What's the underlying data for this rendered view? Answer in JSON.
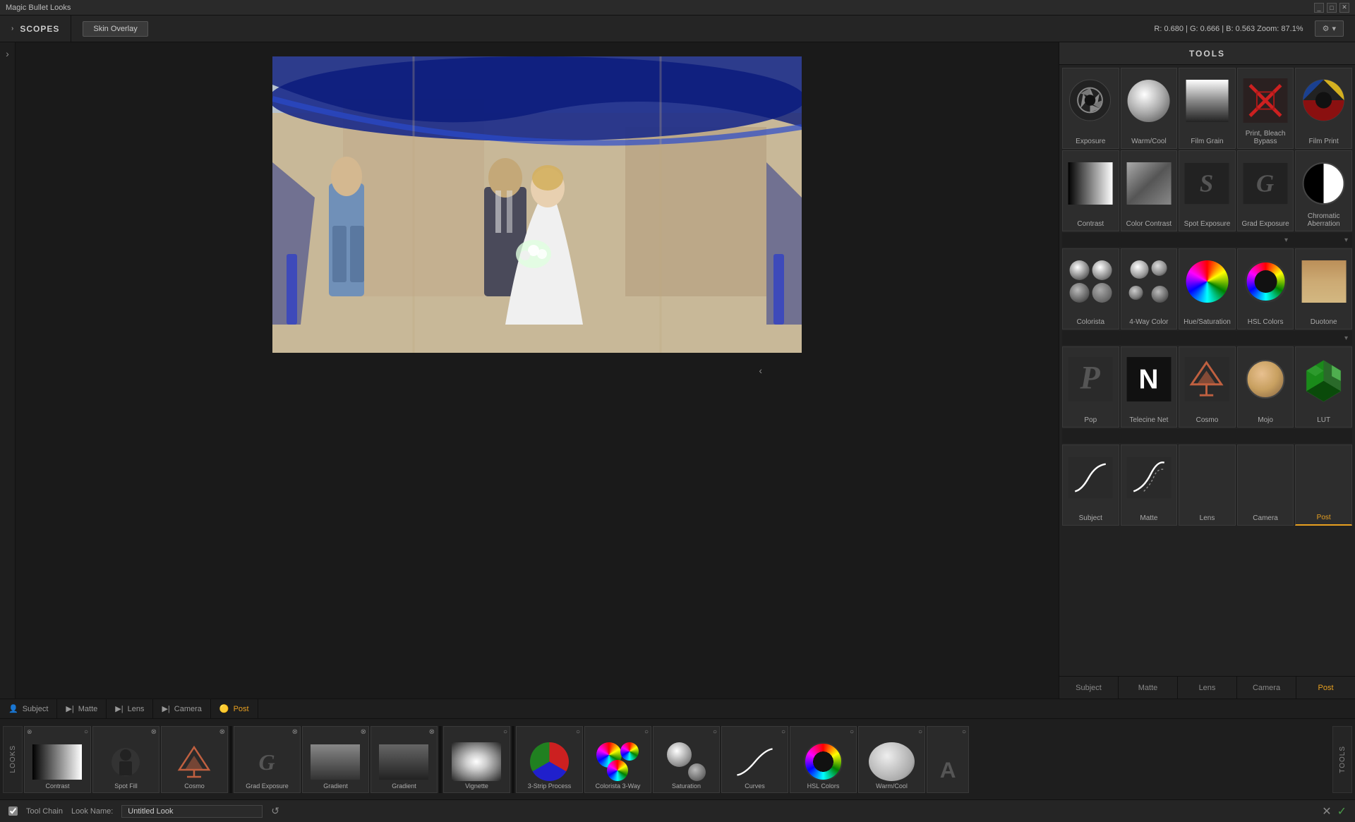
{
  "titlebar": {
    "title": "Magic Bullet Looks",
    "controls": [
      "_",
      "□",
      "✕"
    ]
  },
  "topbar": {
    "scopes_label": "SCOPES",
    "skin_overlay_label": "Skin Overlay",
    "color_info": "R: 0.680  |  G: 0.666  |  B: 0.563    Zoom: 87.1%",
    "settings_label": "⚙ ▾"
  },
  "tools": {
    "header": "TOOLS",
    "rows": [
      [
        {
          "id": "exposure",
          "label": "Exposure",
          "icon": "exposure"
        },
        {
          "id": "warm-cool",
          "label": "Warm/Cool",
          "icon": "sphere"
        },
        {
          "id": "film-grain",
          "label": "Film Grain",
          "icon": "grain"
        },
        {
          "id": "print-bleach",
          "label": "Print, Bleach Bypass",
          "icon": "print-bleach"
        },
        {
          "id": "film-print",
          "label": "Film Print",
          "icon": "film-print"
        }
      ],
      [
        {
          "id": "contrast",
          "label": "Contrast",
          "icon": "contrast"
        },
        {
          "id": "color-contrast",
          "label": "Color Contrast",
          "icon": "color-contrast"
        },
        {
          "id": "spot-exposure",
          "label": "Spot Exposure",
          "icon": "spot"
        },
        {
          "id": "grad-exposure",
          "label": "Grad Exposure",
          "icon": "grad"
        },
        {
          "id": "chromatic",
          "label": "Chromatic Aberration",
          "icon": "chromatic"
        }
      ],
      [
        {
          "id": "colorista",
          "label": "Colorista",
          "icon": "colorista"
        },
        {
          "id": "4way-color",
          "label": "4-Way Color",
          "icon": "fourway"
        },
        {
          "id": "hue-sat",
          "label": "Hue/Saturation",
          "icon": "hue"
        },
        {
          "id": "hsl-colors",
          "label": "HSL Colors",
          "icon": "hsl-colors"
        },
        {
          "id": "duotone",
          "label": "Duotone",
          "icon": "duotone"
        }
      ],
      [
        {
          "id": "pop",
          "label": "Pop",
          "icon": "pop"
        },
        {
          "id": "telecine-net",
          "label": "Telecine Net",
          "icon": "telecine"
        },
        {
          "id": "cosmo",
          "label": "Cosmo",
          "icon": "cosmo"
        },
        {
          "id": "mojo",
          "label": "Mojo",
          "icon": "mojo"
        },
        {
          "id": "lut",
          "label": "LUT",
          "icon": "lut"
        }
      ],
      [
        {
          "id": "subject-tool",
          "label": "Subject",
          "icon": "curves-s"
        },
        {
          "id": "matte-tool",
          "label": "Matte",
          "icon": "curves-diag"
        },
        {
          "id": "lens-tool",
          "label": "Lens",
          "icon": ""
        },
        {
          "id": "camera-tool",
          "label": "Camera",
          "icon": ""
        },
        {
          "id": "post-tool",
          "label": "Post",
          "icon": ""
        }
      ]
    ],
    "tabs": [
      {
        "id": "subject",
        "label": "Subject",
        "active": false
      },
      {
        "id": "matte",
        "label": "Matte",
        "active": false
      },
      {
        "id": "lens",
        "label": "Lens",
        "active": false
      },
      {
        "id": "camera",
        "label": "Camera",
        "active": false
      },
      {
        "id": "post",
        "label": "Post",
        "active": true
      }
    ]
  },
  "filmstrip": {
    "items": [
      {
        "id": "contrast-film",
        "label": "Contrast",
        "icon": "contrast",
        "close": true,
        "enable": true
      },
      {
        "id": "spot-film",
        "label": "Spot Fill",
        "icon": "spot-fill",
        "close": true,
        "enable": true
      },
      {
        "id": "cosmo-film",
        "label": "Cosmo",
        "icon": "cosmo",
        "close": true,
        "enable": true
      },
      {
        "id": "grad-exp-film",
        "label": "Grad Exposure",
        "icon": "grad",
        "close": true,
        "enable": true,
        "separator": true
      },
      {
        "id": "gradient-film",
        "label": "Gradient",
        "icon": "gradient",
        "close": true,
        "enable": true
      },
      {
        "id": "gradient2-film",
        "label": "Gradient",
        "icon": "gradient2",
        "close": true,
        "enable": true
      },
      {
        "id": "vignette-film",
        "label": "Vignette",
        "icon": "vignette",
        "close": true,
        "enable": true,
        "separator": true
      },
      {
        "id": "3strip-film",
        "label": "3-Strip Process",
        "icon": "pie",
        "close": true,
        "enable": true
      },
      {
        "id": "c3way-film",
        "label": "Colorista 3-Way",
        "icon": "c3way",
        "close": true,
        "enable": true
      },
      {
        "id": "saturation-film",
        "label": "Saturation",
        "icon": "saturation",
        "close": true,
        "enable": true
      },
      {
        "id": "curves-film",
        "label": "Curves",
        "icon": "curves-line",
        "close": true,
        "enable": true
      },
      {
        "id": "hsl-film",
        "label": "HSL Colors",
        "icon": "hsl",
        "close": true,
        "enable": true
      },
      {
        "id": "warmc-film",
        "label": "Warm/Cool",
        "icon": "warmc",
        "close": true,
        "enable": true
      },
      {
        "id": "a-film",
        "label": "A",
        "icon": "a-icon",
        "close": true,
        "enable": true
      }
    ],
    "sections": [
      "L",
      "O",
      "O",
      "K",
      "S"
    ]
  },
  "section_labels": [
    {
      "id": "subject-section",
      "label": "Subject",
      "icon": "👤",
      "active": false
    },
    {
      "id": "matte-section",
      "label": "Matte",
      "icon": "▶|",
      "active": false
    },
    {
      "id": "lens-section",
      "label": "Lens",
      "icon": "▶|",
      "active": false
    },
    {
      "id": "camera-section",
      "label": "Camera",
      "icon": "▶|",
      "active": false
    },
    {
      "id": "post-section",
      "label": "Post",
      "icon": "▶|",
      "active": true
    }
  ],
  "toolchain": {
    "label": "Tool Chain",
    "look_name_label": "Look Name:",
    "look_name_value": "Untitled Look",
    "reset_icon": "↺",
    "check_icon": "✓",
    "close_icon": "✕"
  }
}
